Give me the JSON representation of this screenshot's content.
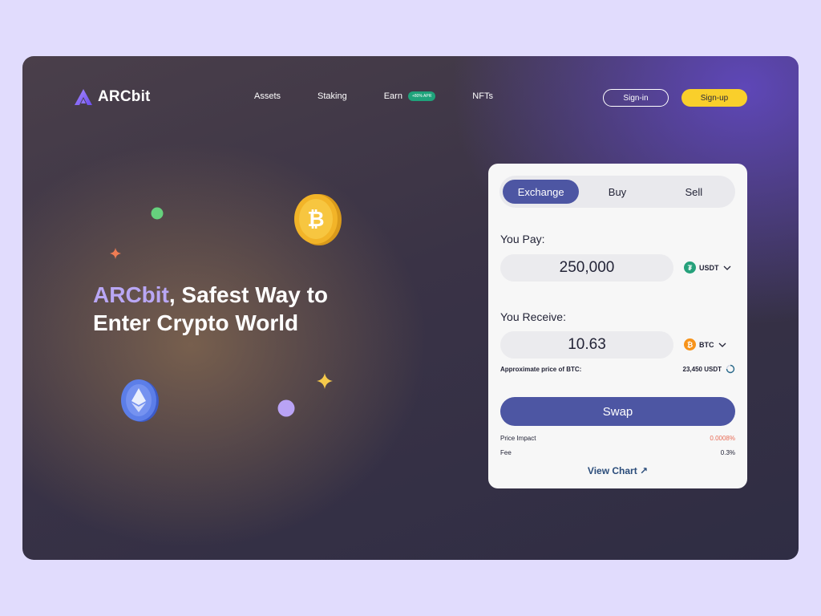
{
  "brand": {
    "name": "ARCbit"
  },
  "nav": {
    "items": [
      {
        "label": "Assets"
      },
      {
        "label": "Staking"
      },
      {
        "label": "Earn",
        "badge": "+80% APR"
      },
      {
        "label": "NFTs"
      }
    ]
  },
  "auth": {
    "signin": "Sign-in",
    "signup": "Sign-up"
  },
  "hero": {
    "accent": "ARCbit",
    "rest": ", Safest Way to Enter Crypto World"
  },
  "exchange": {
    "tabs": [
      {
        "label": "Exchange",
        "active": true
      },
      {
        "label": "Buy"
      },
      {
        "label": "Sell"
      }
    ],
    "pay": {
      "label": "You Pay:",
      "amount": "250,000",
      "token": "USDT"
    },
    "receive": {
      "label": "You Receive:",
      "amount": "10.63",
      "token": "BTC"
    },
    "approx": {
      "label": "Approximate price of BTC:",
      "value": "23,450 USDT"
    },
    "swap_label": "Swap",
    "price_impact": {
      "label": "Price Impact",
      "value": "0.0008%"
    },
    "fee": {
      "label": "Fee",
      "value": "0.3%"
    },
    "view_chart": "View Chart ↗"
  },
  "colors": {
    "accent": "#4d56a3",
    "signup": "#f9cf2b",
    "badge": "#1fa37b",
    "impact": "#e86b55",
    "usdt": "#26a17b",
    "btc": "#f7931a"
  }
}
